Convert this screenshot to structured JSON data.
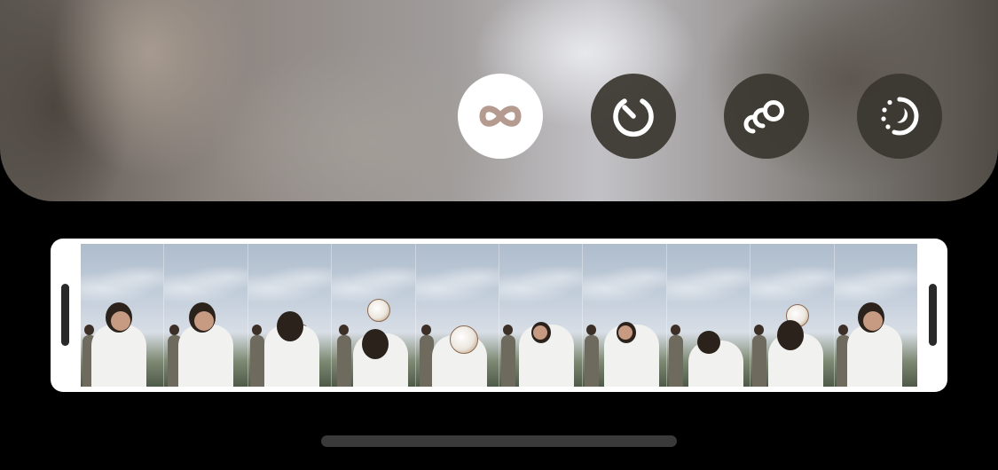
{
  "editor": {
    "modes": [
      {
        "id": "loop",
        "icon": "infinity-icon",
        "active": true
      },
      {
        "id": "speed",
        "icon": "speedometer-icon",
        "active": false
      },
      {
        "id": "echo",
        "icon": "echo-circles-icon",
        "active": false
      },
      {
        "id": "long-exposure",
        "icon": "long-exposure-icon",
        "active": false
      }
    ],
    "colors": {
      "active_button_bg": "#ffffff",
      "active_icon": "#b49a8f",
      "inactive_button_bg": "#3a3630",
      "inactive_icon": "#ffffff",
      "background": "#000000",
      "trimmer_border": "#ffffff",
      "handle": "#2a2a2a",
      "home_indicator": "#3a3a3a"
    },
    "filmstrip": {
      "frame_count": 10
    }
  }
}
